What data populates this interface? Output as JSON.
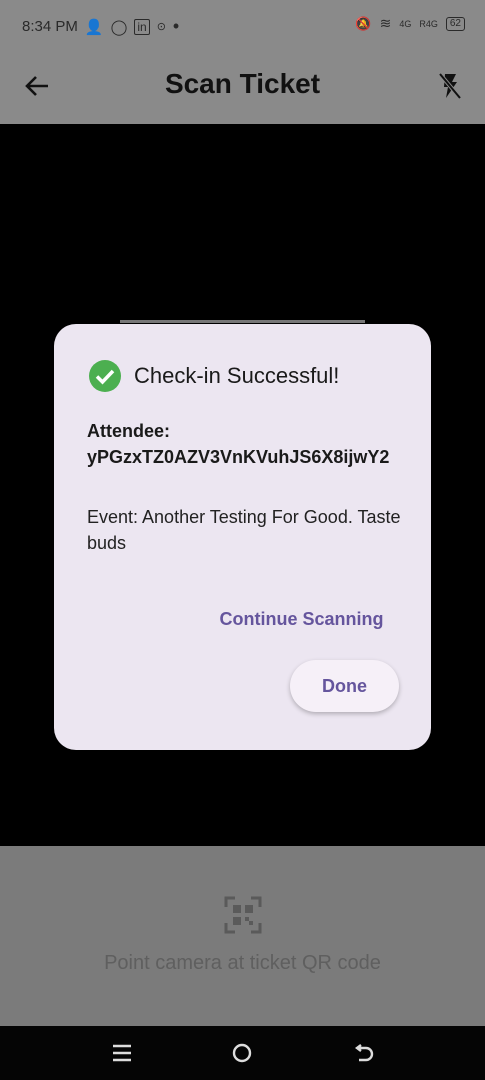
{
  "status_bar": {
    "time": "8:34 PM",
    "network_4g": "4G",
    "network_r4g": "R4G",
    "battery": "62"
  },
  "app_bar": {
    "title": "Scan Ticket"
  },
  "dialog": {
    "title": "Check-in Successful!",
    "attendee_label": "Attendee:",
    "attendee_id": "yPGzxTZ0AZV3VnKVuhJS6X8ijwY2",
    "event_text": "Event: Another Testing For Good. Taste buds",
    "continue_label": "Continue Scanning",
    "done_label": "Done"
  },
  "bottom": {
    "hint": "Point camera at ticket QR code"
  },
  "colors": {
    "accent": "#65559d",
    "success": "#4caf50",
    "dialog_bg": "#ece6f1"
  }
}
